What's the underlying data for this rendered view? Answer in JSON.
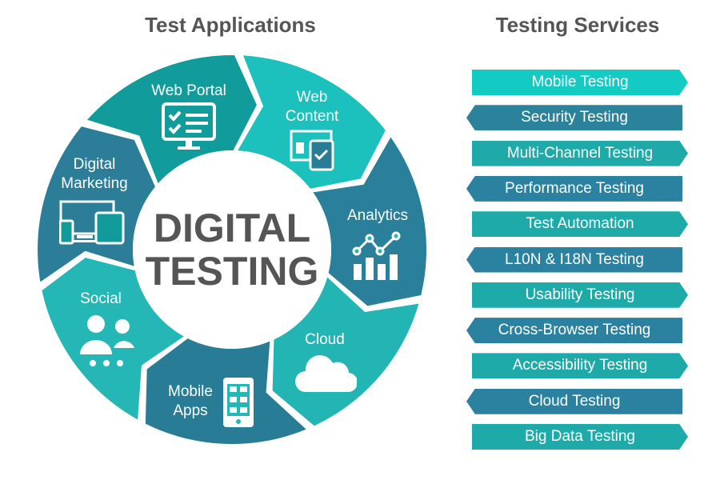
{
  "titles": {
    "left": "Test Applications",
    "right": "Testing Services"
  },
  "center": {
    "line1": "DIGITAL",
    "line2": "TESTING"
  },
  "segments": [
    {
      "label": "Web Portal",
      "icon": "monitor-checklist-icon",
      "color": "#1cc0bd"
    },
    {
      "label": "Web Content",
      "icon": "window-clipboard-icon",
      "color": "#2a7f9a"
    },
    {
      "label": "Analytics",
      "icon": "chart-icon",
      "color": "#22b5b4"
    },
    {
      "label": "Cloud",
      "icon": "cloud-icon",
      "color": "#297c95"
    },
    {
      "label": "Mobile Apps",
      "icon": "phone-grid-icon",
      "color": "#25b7b6"
    },
    {
      "label": "Social",
      "icon": "people-icon",
      "color": "#2b7d98"
    },
    {
      "label": "Digital Marketing",
      "icon": "devices-icon",
      "color": "#129b9b"
    }
  ],
  "services": [
    {
      "label": "Mobile Testing",
      "color": "#13cbc2"
    },
    {
      "label": "Security Testing",
      "color": "#2a839b"
    },
    {
      "label": "Multi-Channel Testing",
      "color": "#1fa9a9"
    },
    {
      "label": "Performance Testing",
      "color": "#2b82a0"
    },
    {
      "label": "Test Automation",
      "color": "#1faaaa"
    },
    {
      "label": "L10N & I18N Testing",
      "color": "#2b82a0"
    },
    {
      "label": "Usability Testing",
      "color": "#1faaaa"
    },
    {
      "label": "Cross-Browser Testing",
      "color": "#2b82a0"
    },
    {
      "label": "Accessibility Testing",
      "color": "#1faaaa"
    },
    {
      "label": "Cloud Testing",
      "color": "#2b82a0"
    },
    {
      "label": "Big Data Testing",
      "color": "#1faaaa"
    }
  ]
}
